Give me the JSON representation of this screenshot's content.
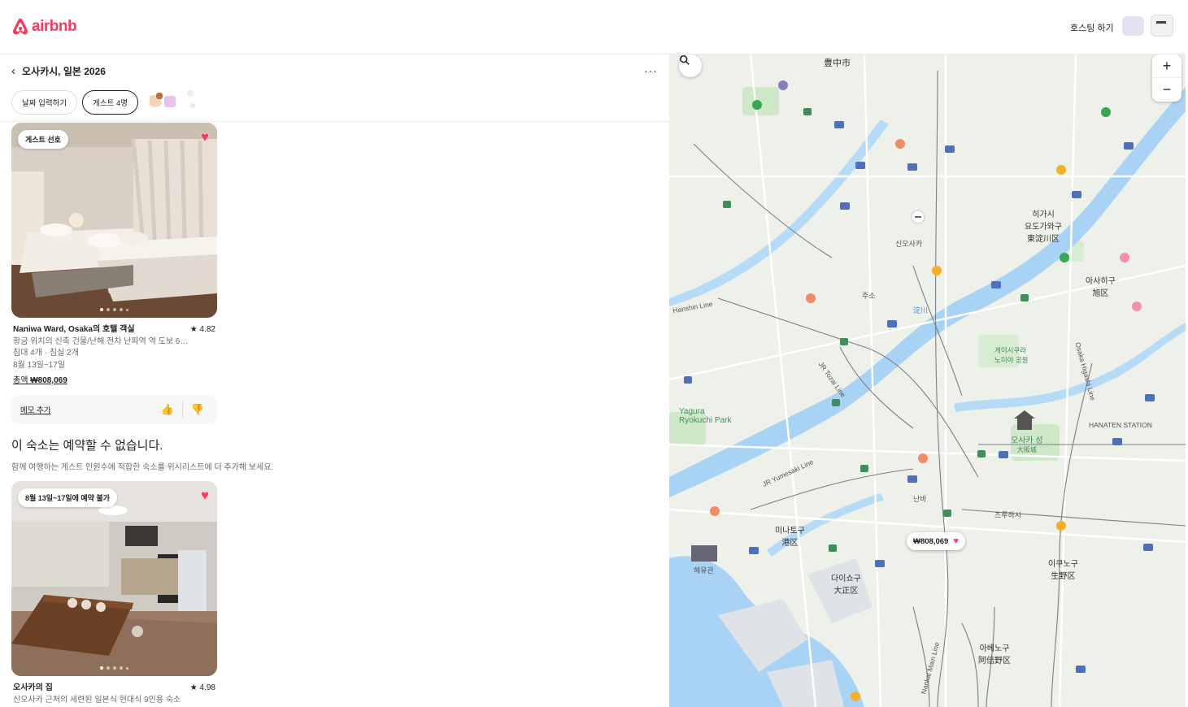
{
  "header": {
    "brand": "airbnb",
    "host_label": "호스팅 하기"
  },
  "wishlist": {
    "title": "오사카시, 일본 2026",
    "more_icon": "more-icon",
    "chips": {
      "dates": "날짜 입력하기",
      "guests": "게스트 4명"
    }
  },
  "listings": [
    {
      "badge": "게스트 선호",
      "name": "Naniwa Ward, Osaka의 호텔 객실",
      "rating": "★ 4.82",
      "desc": "황금 위치의 신축 건물/난해 전차 난파역 역 도보 6분/...",
      "beds": "침대 4개 · 침실 2개",
      "dates": "8월 13일~17일",
      "price_prefix": "총액",
      "price": "₩808,069",
      "memo": "메모 추가",
      "thumb_up": "👍",
      "thumb_down": "👎"
    },
    {
      "badge": "8월 13일~17일에 예약 불가",
      "name": "오사카의 집",
      "rating": "★ 4.98",
      "desc": "신오사카 근처의 세련된 일본식 현대식 9인용 숙소"
    }
  ],
  "unavailable": {
    "heading": "이 숙소는 예약할 수 없습니다.",
    "text": "함께 여행하는 게스트 인원수에 적합한 숙소를 위시리스트에 더 추가해 보세요."
  },
  "map": {
    "pin_price": "₩808,069",
    "labels": {
      "toyonaka": "豊中市",
      "higashiyodogawa": "히가시\n요도가와구",
      "higashiyodogawa_jp": "東淀川区",
      "yodogawa_river": "淀川",
      "osaka_castle": "오사카 성",
      "osaka_castle_jp": "大阪城",
      "minato": "미나토구",
      "minato_jp": "港区",
      "taisho": "다이쇼구",
      "taisho_jp": "大正区",
      "ikuno": "이쿠노구",
      "ikuno_jp": "生野区",
      "abeno": "아베노구",
      "abeno_jp": "阿倍野区",
      "asahi": "아사히구",
      "asahi_jp": "旭区",
      "yagura": "Yagura\nRyokuchi Park",
      "hanaten": "HANATEN STATION",
      "shinosaka": "신오사카",
      "kaiyukan": "해유관",
      "hanshin": "Hanshin Line",
      "jr_tozai": "JR Tozai Line",
      "jr_yumesaki": "JR Yumesaki Line",
      "osaka_higashi": "Osaka Higashi Line",
      "nankai": "Nankai Main Line",
      "tennoji_park": "게이시쿠라\n노미야 공원",
      "juso": "주소",
      "tsuruhashi": "츠루하시",
      "namba": "난바"
    }
  },
  "colors": {
    "accent": "#ff385c",
    "water": "#a9d3f5",
    "park": "#c8e6c0"
  }
}
